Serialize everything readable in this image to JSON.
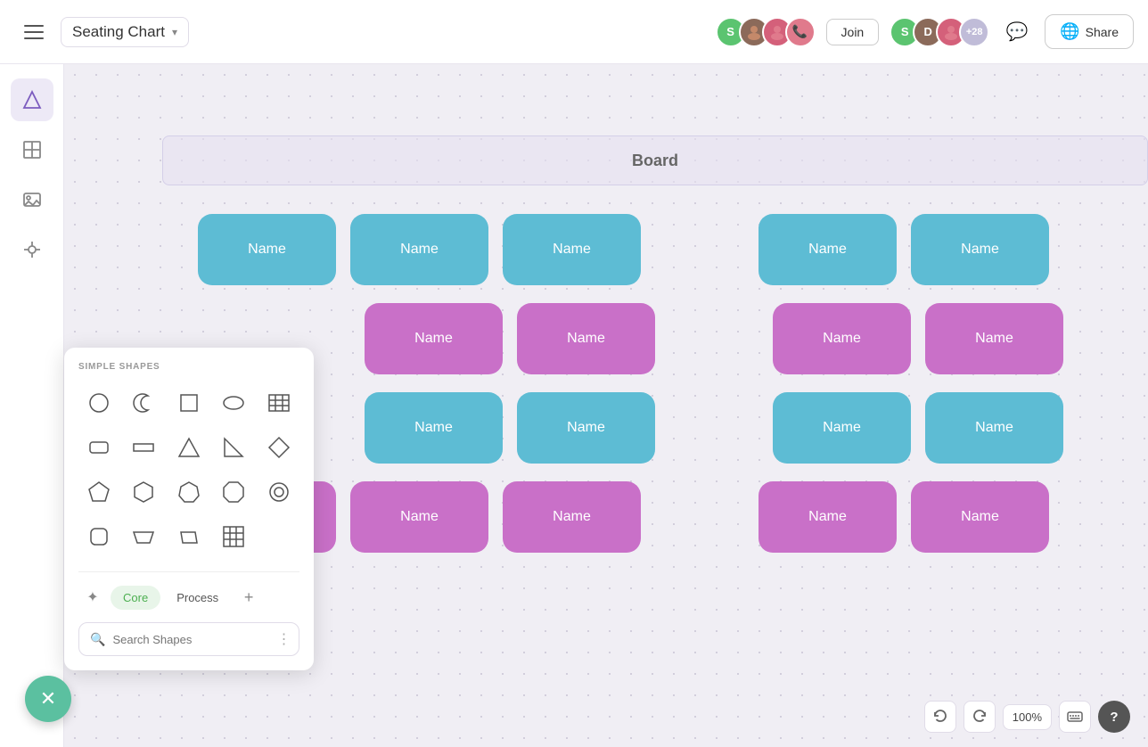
{
  "header": {
    "menu_label": "Menu",
    "title": "Seating Chart",
    "join_label": "Join",
    "share_label": "Share",
    "plus_count": "+28",
    "zoom_level": "100%"
  },
  "canvas": {
    "board_label": "Board"
  },
  "seats": {
    "rows": [
      {
        "color": "blue",
        "cells": [
          "Name",
          "Name",
          "Name"
        ],
        "gap": true,
        "cells2": [
          "Name",
          "Name"
        ]
      },
      {
        "color": "pink",
        "cells": [
          "Name",
          "Name"
        ],
        "gap": true,
        "cells2": [
          "Name",
          "Name"
        ]
      },
      {
        "color": "blue",
        "cells": [
          "Name",
          "Name"
        ],
        "gap": true,
        "cells2": [
          "Name",
          "Name"
        ]
      },
      {
        "color": "pink",
        "cells": [
          "Name",
          "Name"
        ],
        "gap": true,
        "cells2": [
          "Name",
          "Name"
        ]
      }
    ],
    "name_label": "Name"
  },
  "shape_panel": {
    "section_label": "Simple Shapes",
    "tabs": [
      "Core",
      "Process"
    ],
    "active_tab": "Core",
    "search_placeholder": "Search Shapes"
  },
  "bottom_bar": {
    "zoom": "100%",
    "help": "?"
  }
}
